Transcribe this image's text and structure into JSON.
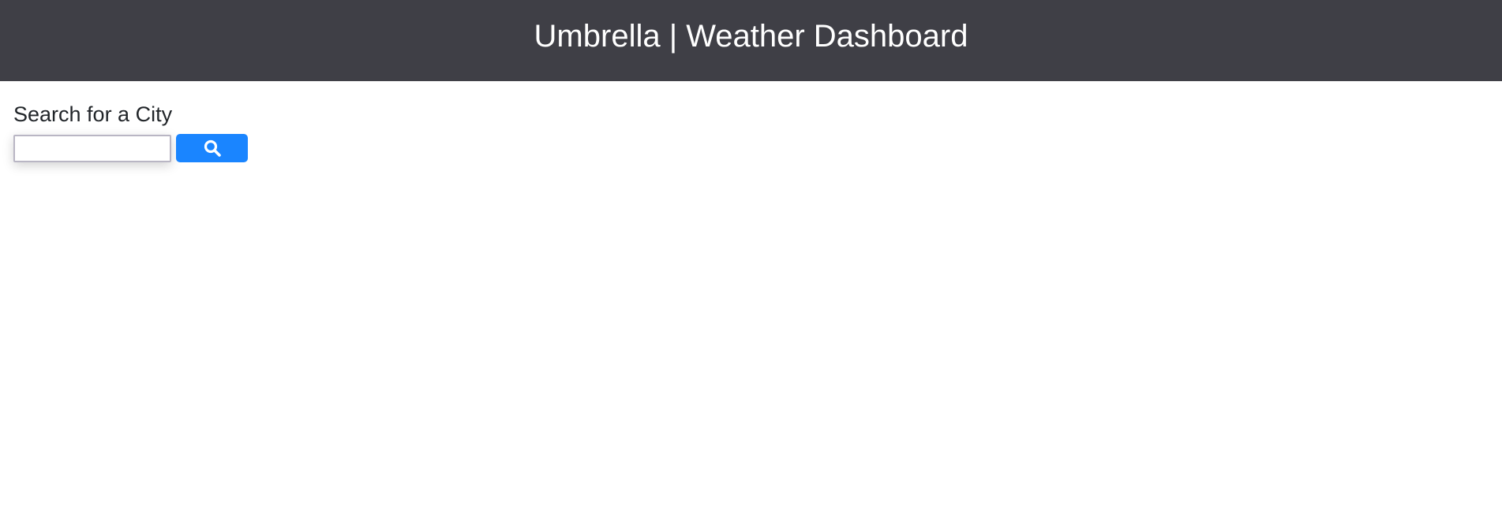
{
  "header": {
    "title": "Umbrella | Weather Dashboard"
  },
  "search": {
    "heading": "Search for a City",
    "input_value": "",
    "placeholder": "",
    "button_icon": "search-icon"
  },
  "colors": {
    "header_bg": "#3f3f46",
    "button_bg": "#1a85ff"
  }
}
